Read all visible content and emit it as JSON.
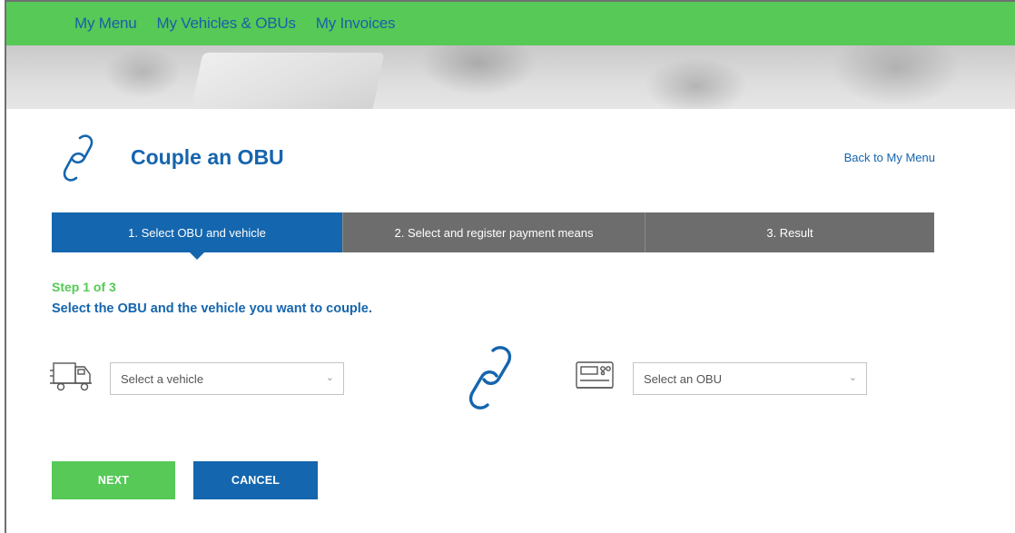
{
  "nav": {
    "items": [
      "My Menu",
      "My Vehicles & OBUs",
      "My Invoices"
    ]
  },
  "header": {
    "title": "Couple an OBU",
    "back_link": "Back to My Menu"
  },
  "steps": [
    {
      "label": "1. Select OBU and vehicle",
      "active": true
    },
    {
      "label": "2. Select and register payment means",
      "active": false
    },
    {
      "label": "3. Result",
      "active": false
    }
  ],
  "form": {
    "step_count": "Step 1 of 3",
    "description": "Select the OBU and the vehicle you want to couple.",
    "vehicle_select": {
      "value": "Select a vehicle",
      "icon": "truck-icon"
    },
    "obu_select": {
      "value": "Select an OBU",
      "icon": "obu-device-icon"
    },
    "link_icon": "chain-link-icon"
  },
  "buttons": {
    "next": "NEXT",
    "cancel": "CANCEL"
  },
  "colors": {
    "nav_green": "#56c957",
    "brand_blue": "#1466ae",
    "step_inactive": "#6d6d6d"
  }
}
